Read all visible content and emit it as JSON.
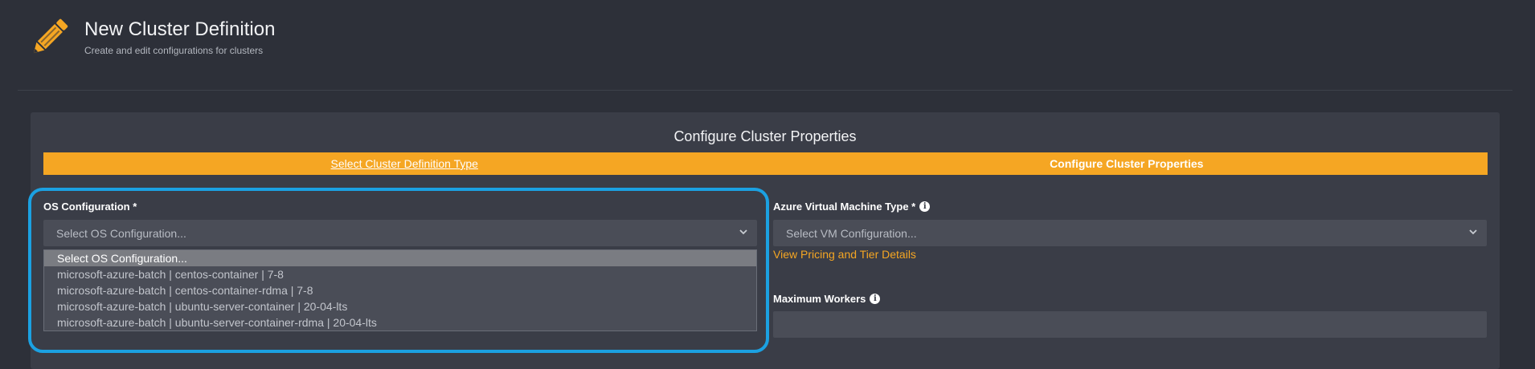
{
  "header": {
    "icon": "pencil-icon",
    "title": "New Cluster Definition",
    "subtitle": "Create and edit configurations for clusters"
  },
  "panel": {
    "title": "Configure Cluster Properties"
  },
  "steps": [
    {
      "label": "Select Cluster Definition Type",
      "state": "link"
    },
    {
      "label": "Configure Cluster Properties",
      "state": "active"
    }
  ],
  "os_config": {
    "label": "OS Configuration *",
    "placeholder": "Select OS Configuration...",
    "options": [
      "Select OS Configuration...",
      "microsoft-azure-batch | centos-container | 7-8",
      "microsoft-azure-batch | centos-container-rdma | 7-8",
      "microsoft-azure-batch | ubuntu-server-container | 20-04-lts",
      "microsoft-azure-batch | ubuntu-server-container-rdma | 20-04-lts"
    ],
    "selected_index": 0
  },
  "vm_type": {
    "label": "Azure Virtual Machine Type *",
    "placeholder": "Select VM Configuration...",
    "pricing_link": "View Pricing and Tier Details"
  },
  "max_workers": {
    "label": "Maximum Workers",
    "value": ""
  },
  "colors": {
    "background": "#2d3039",
    "panel": "#3a3d47",
    "accent": "#f5a623",
    "highlight": "#1ba1e2"
  },
  "icons": [
    "pencil-icon",
    "chevron-down-icon",
    "info-icon"
  ]
}
